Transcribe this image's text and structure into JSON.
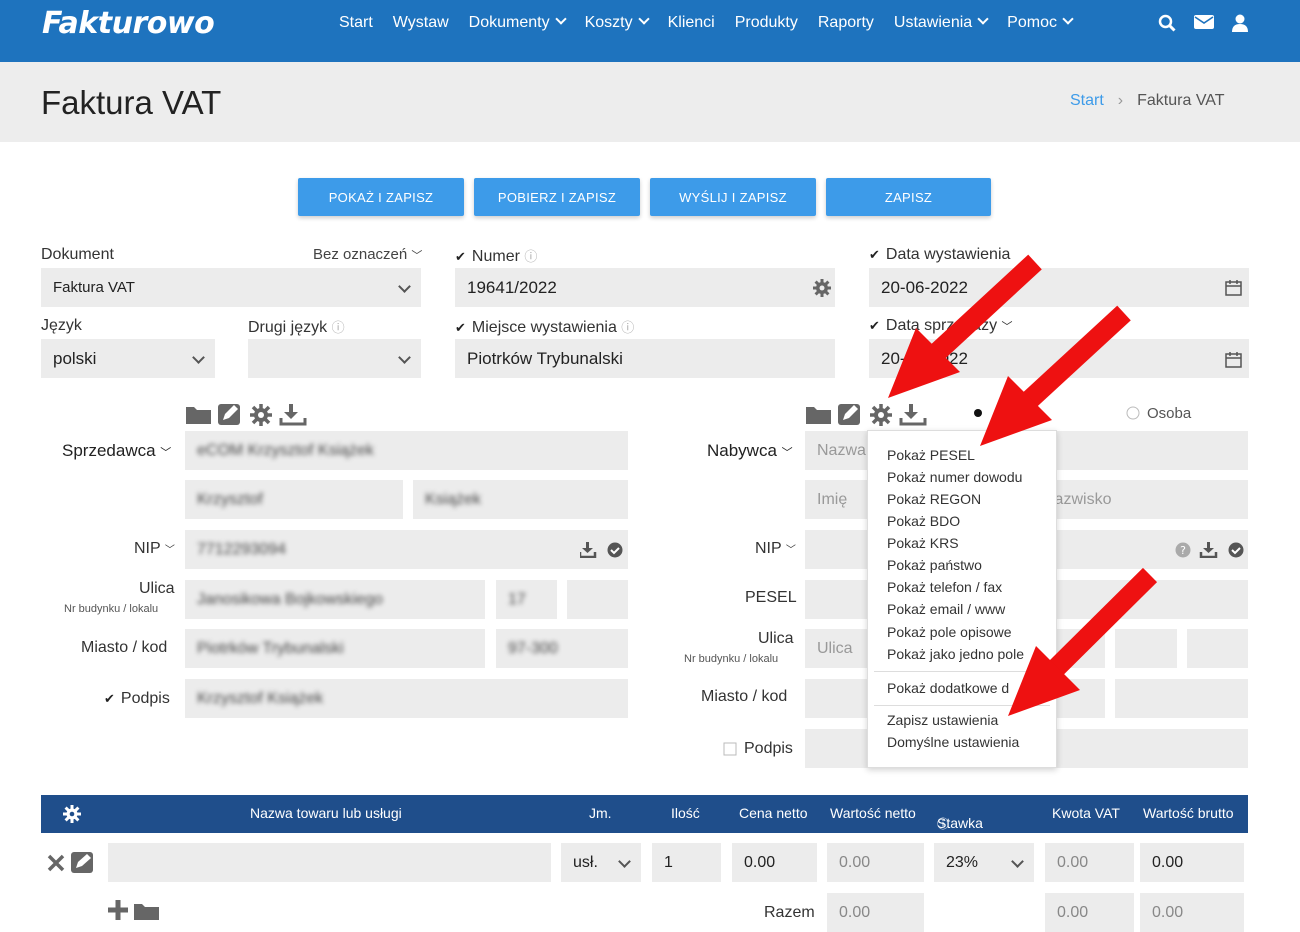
{
  "header": {
    "logo": "Fakturowo",
    "nav": [
      "Start",
      "Wystaw",
      "Dokumenty",
      "Koszty",
      "Klienci",
      "Produkty",
      "Raporty",
      "Ustawienia",
      "Pomoc"
    ],
    "icons": [
      "search-icon",
      "mail-icon",
      "user-icon"
    ]
  },
  "page": {
    "title": "Faktura VAT",
    "breadcrumb": {
      "home": "Start",
      "current": "Faktura VAT"
    }
  },
  "actions": [
    "POKAŻ I ZAPISZ",
    "POBIERZ I ZAPISZ",
    "WYŚLIJ I ZAPISZ",
    "ZAPISZ"
  ],
  "form": {
    "dokument_label": "Dokument",
    "dokument_value": "Faktura VAT",
    "oznaczen": "Bez oznaczeń",
    "numer_label": "Numer",
    "numer_value": "19641/2022",
    "data_wyst_label": "Data wystawienia",
    "data_wyst_value": "20-06-2022",
    "jezyk_label": "Język",
    "jezyk_value": "polski",
    "drugi_jezyk_label": "Drugi język",
    "miejsce_label": "Miejsce wystawienia",
    "miejsce_value": "Piotrków Trybunalski",
    "data_spr_label": "Data sprzedaży",
    "data_spr_value": "20-06-2022"
  },
  "seller": {
    "label": "Sprzedawca",
    "nip_label": "NIP",
    "ulica_label": "Ulica",
    "ulica_sub": "Nr budynku / lokalu",
    "miasto_label": "Miasto / kod",
    "podpis_label": "Podpis"
  },
  "buyer": {
    "label": "Nabywca",
    "name_placeholder": "Nazwa",
    "imie_placeholder": "Imię",
    "nazwisko_placeholder": "Nazwisko",
    "nip_label": "NIP",
    "pesel_label": "PESEL",
    "ulica_label": "Ulica",
    "ulica_sub": "Nr budynku / lokalu",
    "ulica_placeholder": "Ulica",
    "miasto_label": "Miasto / kod",
    "podpis_label": "Podpis",
    "osoba_label": "Osoba"
  },
  "menu": {
    "items": [
      "Pokaż PESEL",
      "Pokaż numer dowodu",
      "Pokaż REGON",
      "Pokaż BDO",
      "Pokaż KRS",
      "Pokaż państwo",
      "Pokaż telefon / fax",
      "Pokaż email / www",
      "Pokaż pole opisowe",
      "Pokaż jako jedno pole"
    ],
    "extra": "Pokaż dodatkowe d",
    "save": "Zapisz ustawienia",
    "defaults": "Domyślne ustawienia"
  },
  "table": {
    "headers": [
      "Nazwa towaru lub usługi",
      "Jm.",
      "Ilość",
      "Cena netto",
      "Wartość netto",
      "Stawka VAT",
      "Kwota VAT",
      "Wartość brutto"
    ],
    "row": {
      "jm": "usł.",
      "ilosc": "1",
      "cena": "0.00",
      "netto": "0.00",
      "vat_rate": "23%",
      "vat": "0.00",
      "brutto": "0.00"
    },
    "sum_label": "Razem",
    "sum_netto": "0.00",
    "sum_vat": "0.00",
    "sum_brutto": "0.00"
  },
  "colors": {
    "primary": "#1e73be",
    "accent": "#3d9be9",
    "table_header": "#1f4e8b",
    "arrow": "#ee1111"
  }
}
